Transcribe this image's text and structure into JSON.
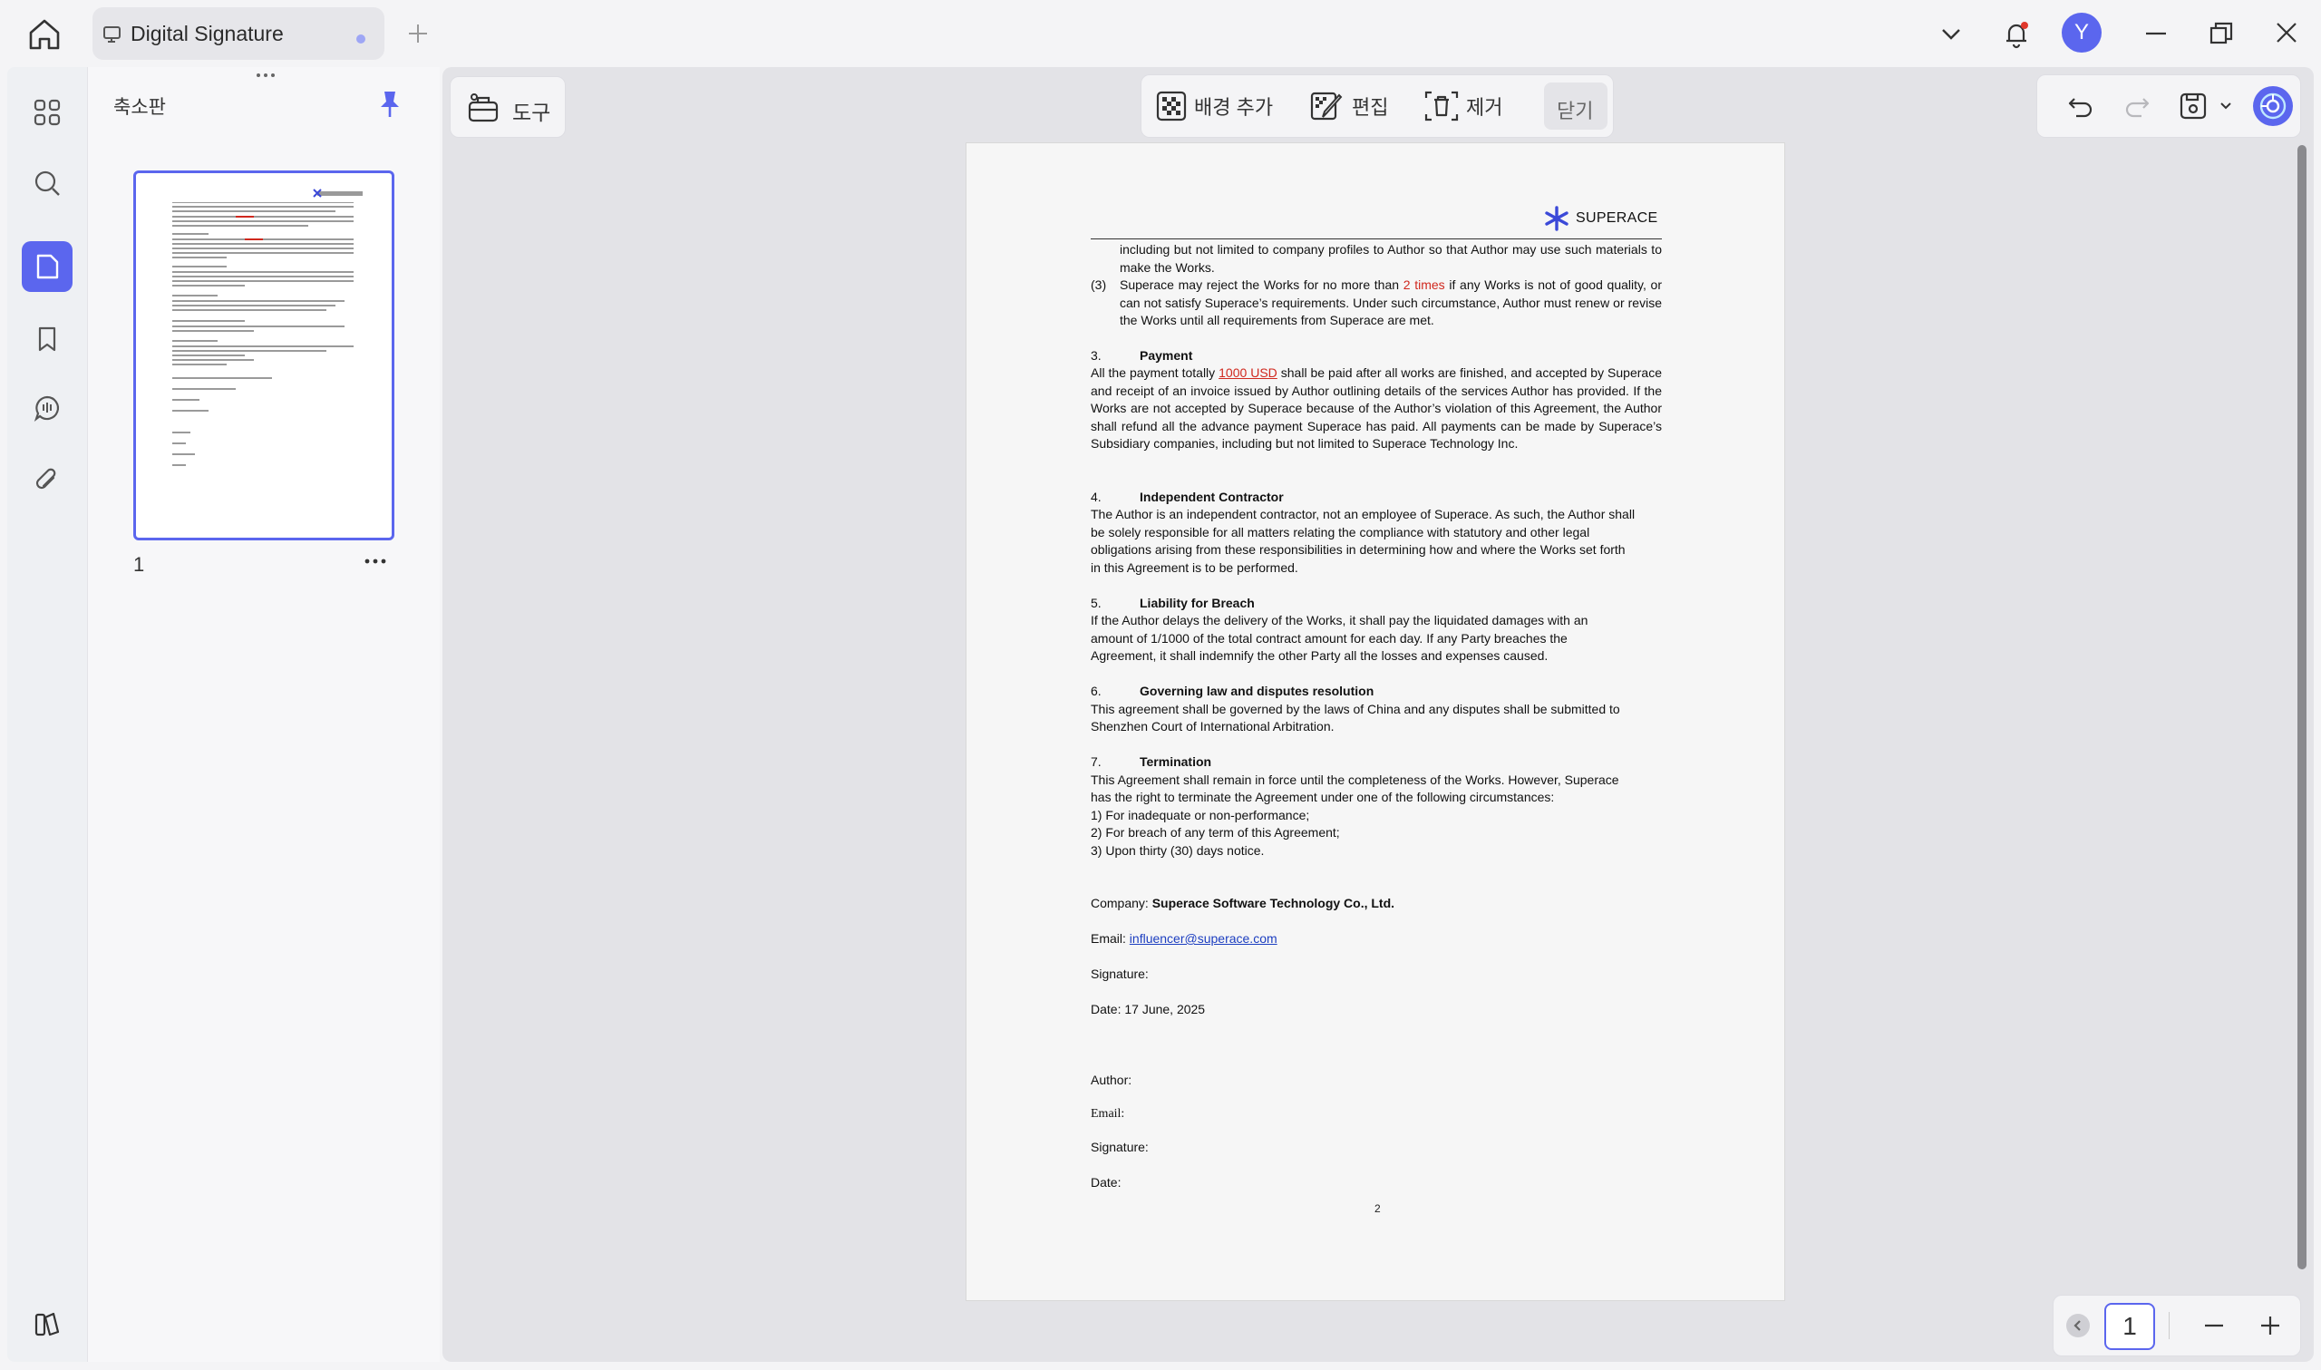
{
  "tab": {
    "title": "Digital Signature"
  },
  "user": {
    "avatar_letter": "Y",
    "avatar_color": "#5b66ee"
  },
  "accent": "#5b66ee",
  "rail": {
    "items": [
      "thumbnails-icon",
      "search-icon",
      "pages-icon",
      "bookmark-icon",
      "comment-icon",
      "attachment-icon"
    ],
    "bottom": "library-icon"
  },
  "thumb_panel": {
    "title": "축소판",
    "page_number": "1"
  },
  "toolbar": {
    "tool_label": "도구"
  },
  "bg_toolbar": {
    "add_bg": "배경 추가",
    "edit": "편집",
    "remove": "제거",
    "close": "닫기"
  },
  "page_nav": {
    "current_page": "1"
  },
  "doc": {
    "logo": "SUPERACE",
    "p_intro": "including but not limited to company profiles to Author so that Author may use such materials to make the Works.",
    "item3_num": "(3)",
    "item3_a": "Superace may reject the Works for no more than ",
    "item3_red": "2 times",
    "item3_b": " if any Works is not of good quality, or can not satisfy Superace’s requirements. Under such circumstance, Author must renew or revise the Works until all requirements from Superace are met.",
    "s3_num": "3.",
    "s3_title": "Payment",
    "s3_a": "All the payment totally ",
    "s3_red": "1000 USD",
    "s3_b": " shall be paid after all works are finished, and accepted by Superace and receipt of an invoice issued by Author outlining details of the services Author has provided. If the Works are not accepted by Superace because of the Author’s violation of this Agreement, the Author shall refund all the advance payment Superace has paid. All payments can be made by Superace’s Subsidiary companies, including but not limited to Superace Technology Inc.",
    "s4_num": "4.",
    "s4_title": "Independent Contractor",
    "s4_l1": "The Author is an independent contractor, not an employee of Superace. As such, the Author shall",
    "s4_l2": "be solely responsible for all matters relating the compliance with statutory and other legal",
    "s4_l3": "obligations arising from these responsibilities in determining how and where the Works set forth",
    "s4_l4": "in this Agreement is to be performed.",
    "s5_num": "5.",
    "s5_title": "Liability for Breach",
    "s5_l1": "If the Author delays the delivery of the Works, it shall pay the liquidated damages with an",
    "s5_l2": "amount of 1/1000 of the total contract amount for each day. If any Party breaches the",
    "s5_l3": "Agreement, it shall indemnify the other Party all the losses and expenses caused.",
    "s6_num": "6.",
    "s6_title": "Governing law and disputes resolution",
    "s6_l1": "This agreement shall be governed by the laws of China and any disputes shall be submitted to",
    "s6_l2": "Shenzhen Court of International Arbitration.",
    "s7_num": "7.",
    "s7_title": "Termination",
    "s7_l1": "This Agreement shall remain in force until the completeness of the Works. However, Superace",
    "s7_l2": "has the right to terminate the Agreement under one of the following circumstances:",
    "s7_l3": "1) For inadequate or non-performance;",
    "s7_l4": "2) For breach of any term of this Agreement;",
    "s7_l5": "3)  Upon thirty (30) days notice.",
    "company_label": "Company: ",
    "company_value": "Superace Software Technology Co., Ltd.",
    "email_label": "Email: ",
    "email_value": "influencer@superace.com",
    "signature_label": "Signature:",
    "date_line": "Date: 17 June, 2025",
    "author_label": "Author:",
    "author_email_label": "Email:",
    "author_signature_label": "Signature:",
    "author_date_label": "Date:",
    "page_number": "2"
  }
}
